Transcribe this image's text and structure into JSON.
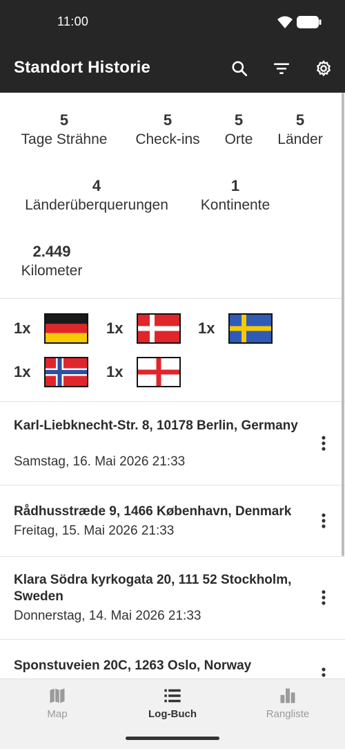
{
  "status_bar": {
    "time": "11:00"
  },
  "app_bar": {
    "title": "Standort Historie",
    "search_icon": "search-icon",
    "filter_icon": "filter-icon",
    "settings_icon": "gear-icon"
  },
  "stats": {
    "streak": {
      "value": "5",
      "label": "Tage Strähne"
    },
    "checkins": {
      "value": "5",
      "label": "Check-ins"
    },
    "places": {
      "value": "5",
      "label": "Orte"
    },
    "countries": {
      "value": "5",
      "label": "Länder"
    },
    "crossings": {
      "value": "4",
      "label": "Länderüberquerungen"
    },
    "continents": {
      "value": "1",
      "label": "Kontinente"
    },
    "kilometers": {
      "value": "2.449",
      "label": "Kilometer"
    }
  },
  "flags": [
    {
      "count": "1x",
      "country": "Germany"
    },
    {
      "count": "1x",
      "country": "Denmark"
    },
    {
      "count": "1x",
      "country": "Sweden"
    },
    {
      "count": "1x",
      "country": "Norway"
    },
    {
      "count": "1x",
      "country": "England"
    }
  ],
  "entries": [
    {
      "address": "Karl-Liebknecht-Str. 8, 10178 Berlin, Germany",
      "date": "Samstag, 16. Mai 2026 21:33"
    },
    {
      "address": "Rådhusstræde 9, 1466 København, Denmark",
      "date": "Freitag, 15. Mai 2026 21:33"
    },
    {
      "address": "Klara Södra kyrkogata 20, 111 52 Stockholm, Sweden",
      "date": "Donnerstag, 14. Mai 2026 21:33"
    },
    {
      "address": "Sponstuveien 20C, 1263 Oslo, Norway",
      "date": ""
    }
  ],
  "bottom_nav": {
    "items": [
      {
        "label": "Map",
        "icon": "map-icon",
        "active": false
      },
      {
        "label": "Log-Buch",
        "icon": "list-icon",
        "active": true
      },
      {
        "label": "Rangliste",
        "icon": "bar-chart-icon",
        "active": false
      }
    ],
    "active_color": "#333333",
    "inactive_color": "#9a9a9a"
  }
}
